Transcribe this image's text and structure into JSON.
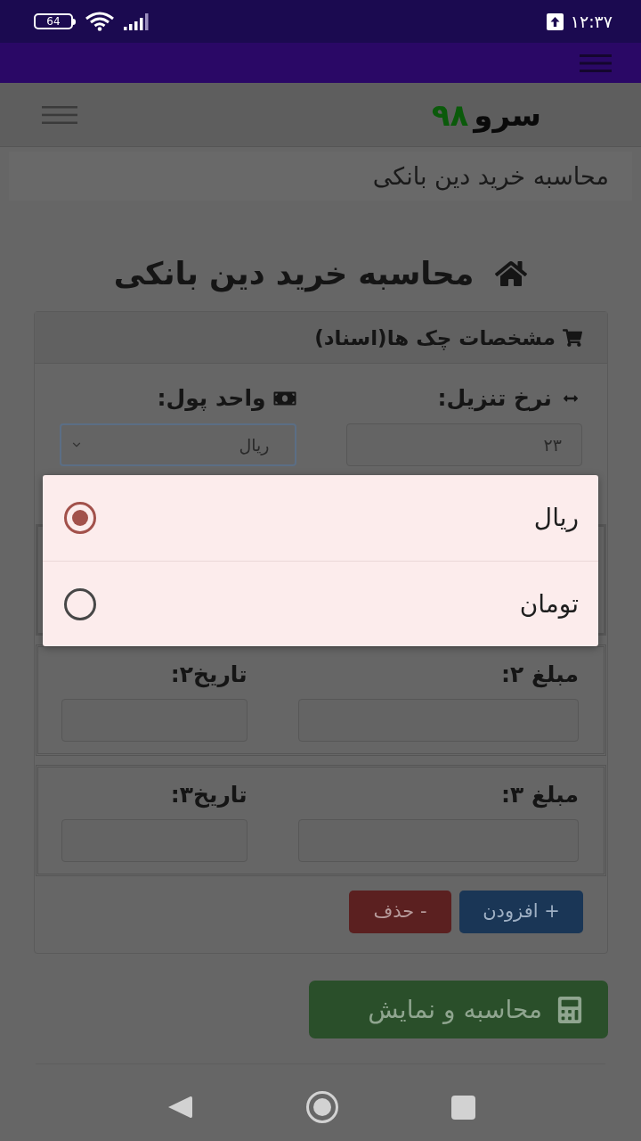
{
  "status_bar": {
    "time": "۱۲:۳۷",
    "battery": "64"
  },
  "navbar": {
    "logo_word": "سرو",
    "logo_number": "۹۸"
  },
  "breadcrumb": "محاسبه خرید دین بانکی",
  "page_title": "محاسبه خرید دین بانکی",
  "card": {
    "header": "مشخصات چک ها(اسناد)",
    "discount_rate": {
      "label": "نرخ تنزیل:",
      "value": "۲۳"
    },
    "currency": {
      "label": "واحد پول:",
      "value": "ریال",
      "focused": true
    },
    "checks": [
      {
        "amount_label": "مبلغ ۲:",
        "date_label": "تاریخ۲:"
      },
      {
        "amount_label": "مبلغ ۳:",
        "date_label": "تاریخ۳:"
      }
    ],
    "buttons": [
      {
        "label": "+ افزودن",
        "kind": "add"
      },
      {
        "label": "- حذف",
        "kind": "remove"
      }
    ]
  },
  "submit_button": {
    "label": "محاسبه و نمایش"
  },
  "currency_dialog": {
    "options": [
      {
        "label": "ریال",
        "selected": true
      },
      {
        "label": "تومان",
        "selected": false
      }
    ]
  }
}
